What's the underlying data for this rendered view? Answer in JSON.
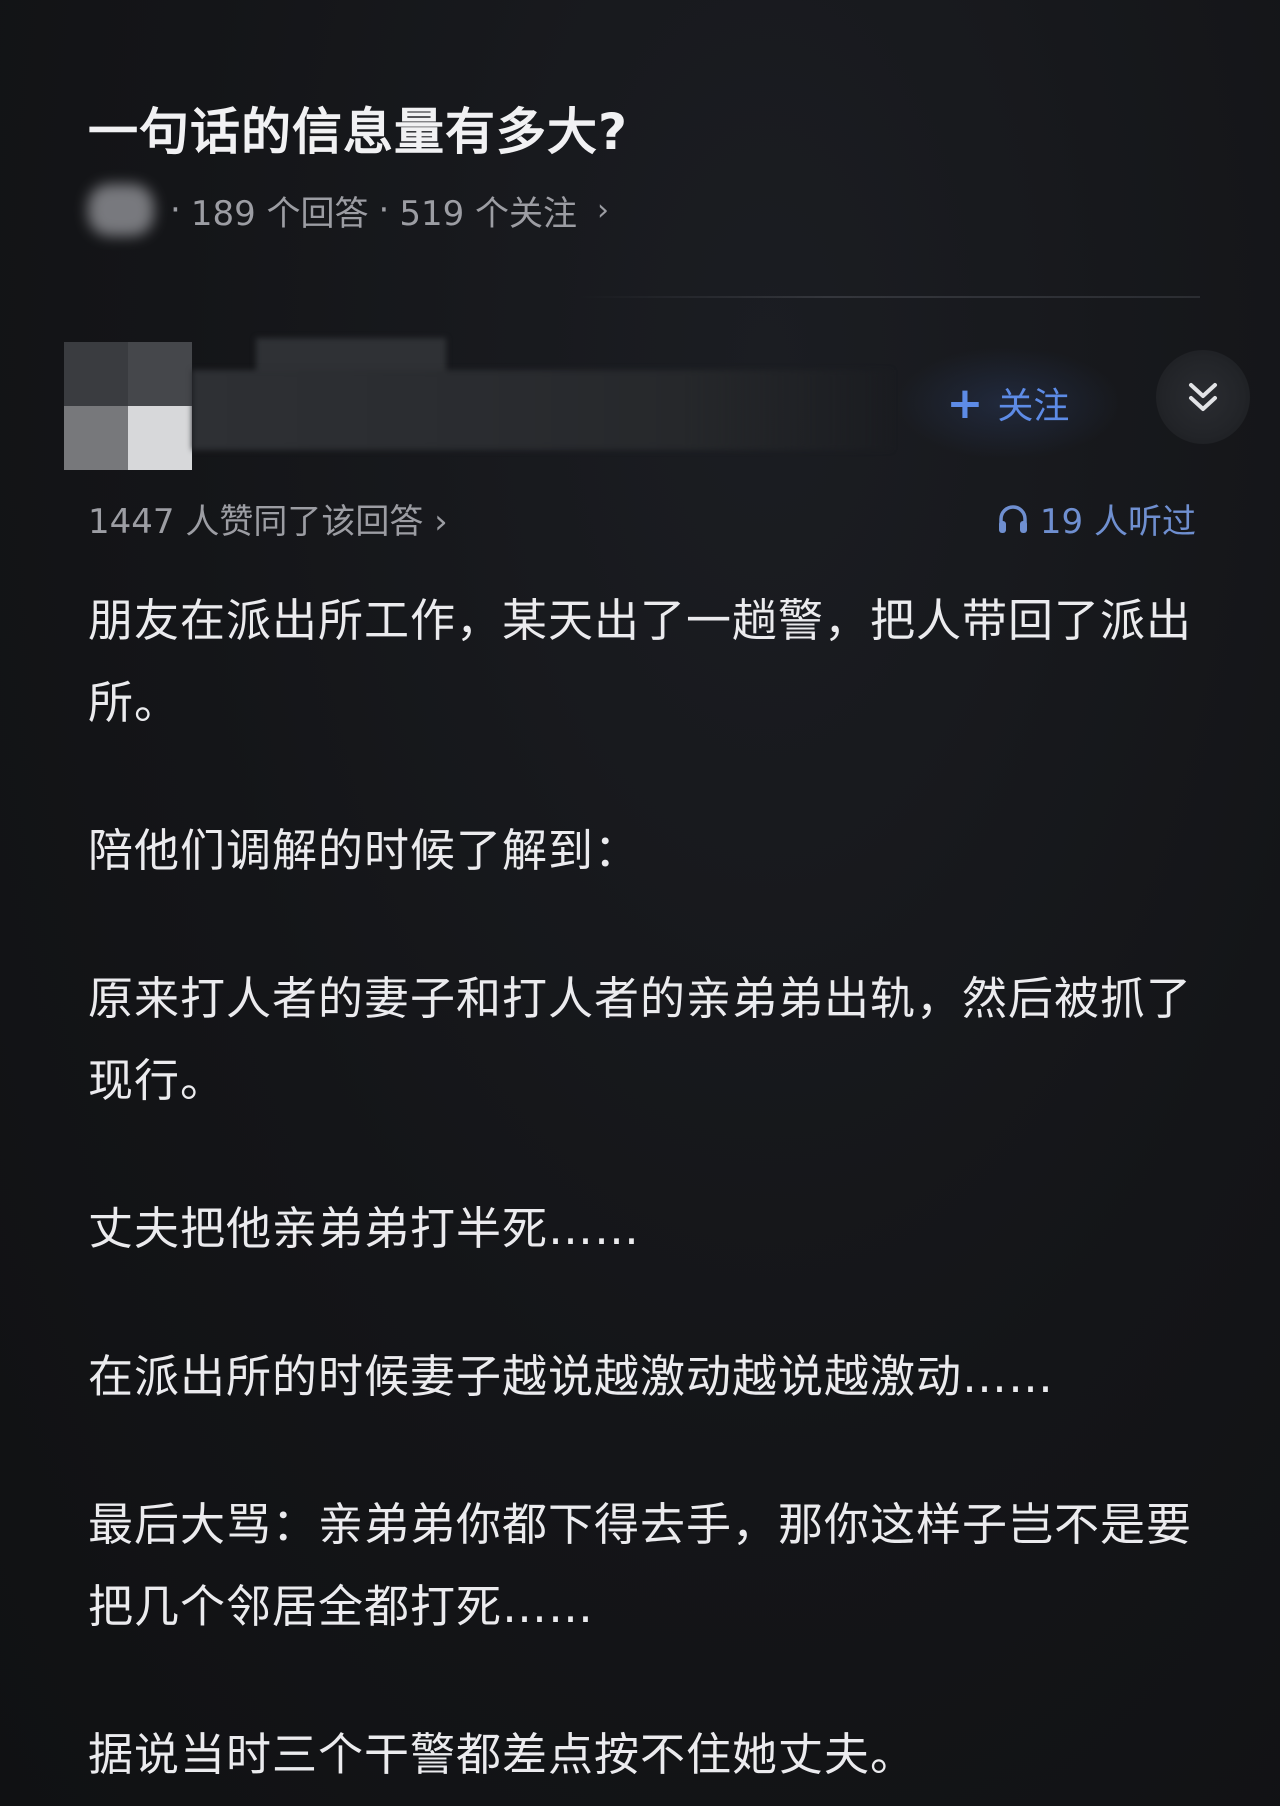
{
  "question": {
    "title": "一句话的信息量有多大?",
    "meta": {
      "answers": "189 个回答",
      "followers": "519 个关注"
    }
  },
  "author": {
    "follow_label": "关注"
  },
  "stats": {
    "agree_text": "1447 人赞同了该回答 ›",
    "listened_text": "19 人听过"
  },
  "answer": {
    "paragraphs": [
      "朋友在派出所工作，某天出了一趟警，把人带回了派出所。",
      "陪他们调解的时候了解到：",
      "原来打人者的妻子和打人者的亲弟弟出轨，然后被抓了现行。",
      "丈夫把他亲弟弟打半死……",
      "在派出所的时候妻子越说越激动越说越激动……",
      "最后大骂：亲弟弟你都下得去手，那你这样子岂不是要把几个邻居全都打死……",
      "据说当时三个干警都差点按不住她丈夫。"
    ]
  },
  "colors": {
    "background": "#121316",
    "text_primary": "#ebebee",
    "text_secondary": "#9c9da3",
    "accent_blue": "#5d8be6"
  }
}
